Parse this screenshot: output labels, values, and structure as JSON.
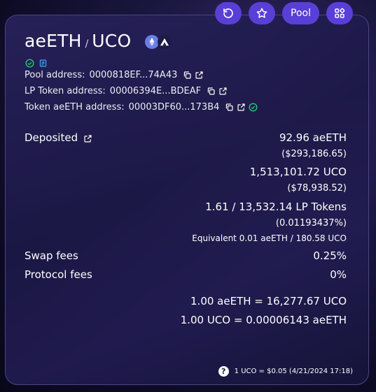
{
  "header": {
    "pool_button_label": "Pool"
  },
  "pair": {
    "token1": "aeETH",
    "separator": "/",
    "token2": "UCO"
  },
  "addresses": {
    "pool_label": "Pool address:",
    "pool_value": "0000818EF...74A43",
    "lp_label": "LP Token address:",
    "lp_value": "00006394E...BDEAF",
    "token_label": "Token aeETH address:",
    "token_value": "00003DF60...173B4"
  },
  "deposited": {
    "label": "Deposited",
    "token1_amount": "92.96 aeETH",
    "token1_usd": "($293,186.65)",
    "token2_amount": "1,513,101.72 UCO",
    "token2_usd": "($78,938.52)",
    "lp_tokens": "1.61  / 13,532.14 LP Tokens",
    "lp_share": "(0.01193437%)",
    "equivalent": "Equivalent 0.01 aeETH / 180.58 UCO"
  },
  "fees": {
    "swap_label": "Swap fees",
    "swap_value": "0.25%",
    "protocol_label": "Protocol fees",
    "protocol_value": "0%"
  },
  "rates": {
    "rate1": "1.00 aeETH = 16,277.67 UCO",
    "rate2": "1.00 UCO = 0.00006143 aeETH"
  },
  "footer": {
    "help_glyph": "?",
    "price_info": "1 UCO = $0.05 (4/21/2024 17:18)"
  },
  "colors": {
    "accent": "#5a3fd6",
    "verified": "#2ecc71",
    "info": "#4aa3ff"
  }
}
